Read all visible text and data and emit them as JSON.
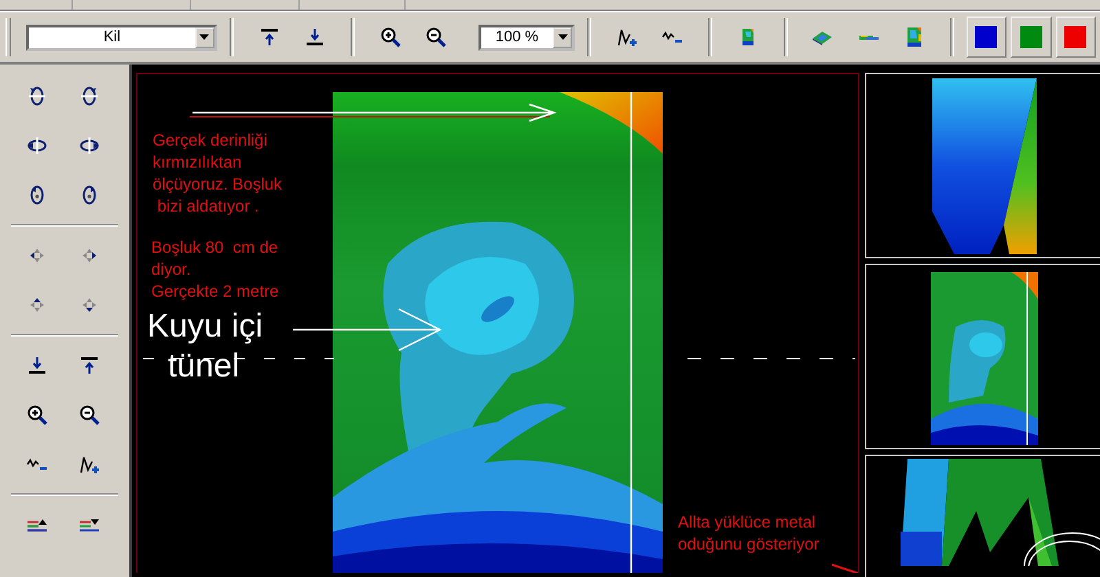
{
  "toolbar": {
    "material": {
      "value": "Kil"
    },
    "zoom": {
      "value": "100 %"
    },
    "swatches": [
      {
        "color": "#0000cc"
      },
      {
        "color": "#008a10"
      },
      {
        "color": "#ee0000"
      }
    ]
  },
  "main_view": {
    "annotations": [
      {
        "kind": "note",
        "lines": [
          "Gerçek derinliği",
          "kırmızılıktan",
          "ölçüyoruz. Boşluk",
          " bizi aldatıyor ."
        ]
      },
      {
        "kind": "note",
        "lines": [
          "Boşluk 80  cm de",
          "diyor.",
          "Gerçekte 2 metre"
        ]
      },
      {
        "kind": "label",
        "lines": [
          "Kuyu içi"
        ]
      },
      {
        "kind": "label",
        "lines": [
          "tünel"
        ]
      },
      {
        "kind": "note",
        "lines": [
          "Allta yüklüce metal",
          "oduğunu gösteriyor"
        ]
      }
    ]
  }
}
